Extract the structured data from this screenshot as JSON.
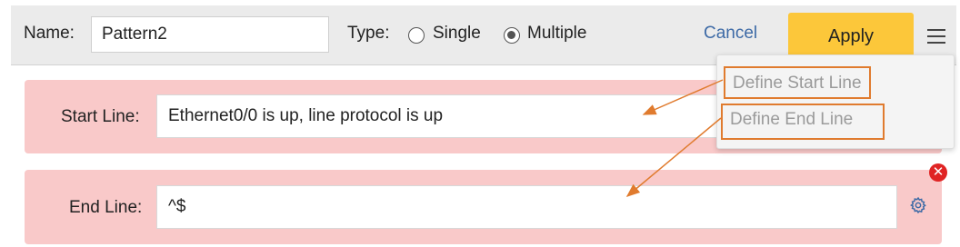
{
  "toolbar": {
    "name_label": "Name:",
    "name_value": "Pattern2",
    "type_label": "Type:",
    "type_options": [
      "Single",
      "Multiple"
    ],
    "type_selected": "Multiple",
    "cancel_label": "Cancel",
    "apply_label": "Apply",
    "menu_icon": "hamburger-menu-icon"
  },
  "start_line": {
    "label": "Start Line:",
    "value": "Ethernet0/0 is up, line protocol is up"
  },
  "end_line": {
    "label": "End Line:",
    "value": "^$",
    "settings_icon": "gear-icon",
    "remove_icon": "close-icon"
  },
  "menu": {
    "items": [
      "Define Start Line",
      "Define End Line"
    ]
  },
  "colors": {
    "toolbar_bg": "#ebebeb",
    "panel_bg": "#f9c9c9",
    "apply_bg": "#fcc73a",
    "cancel_text": "#3d6aa6",
    "highlight_border": "#e07b2e",
    "close_badge": "#e02424"
  }
}
